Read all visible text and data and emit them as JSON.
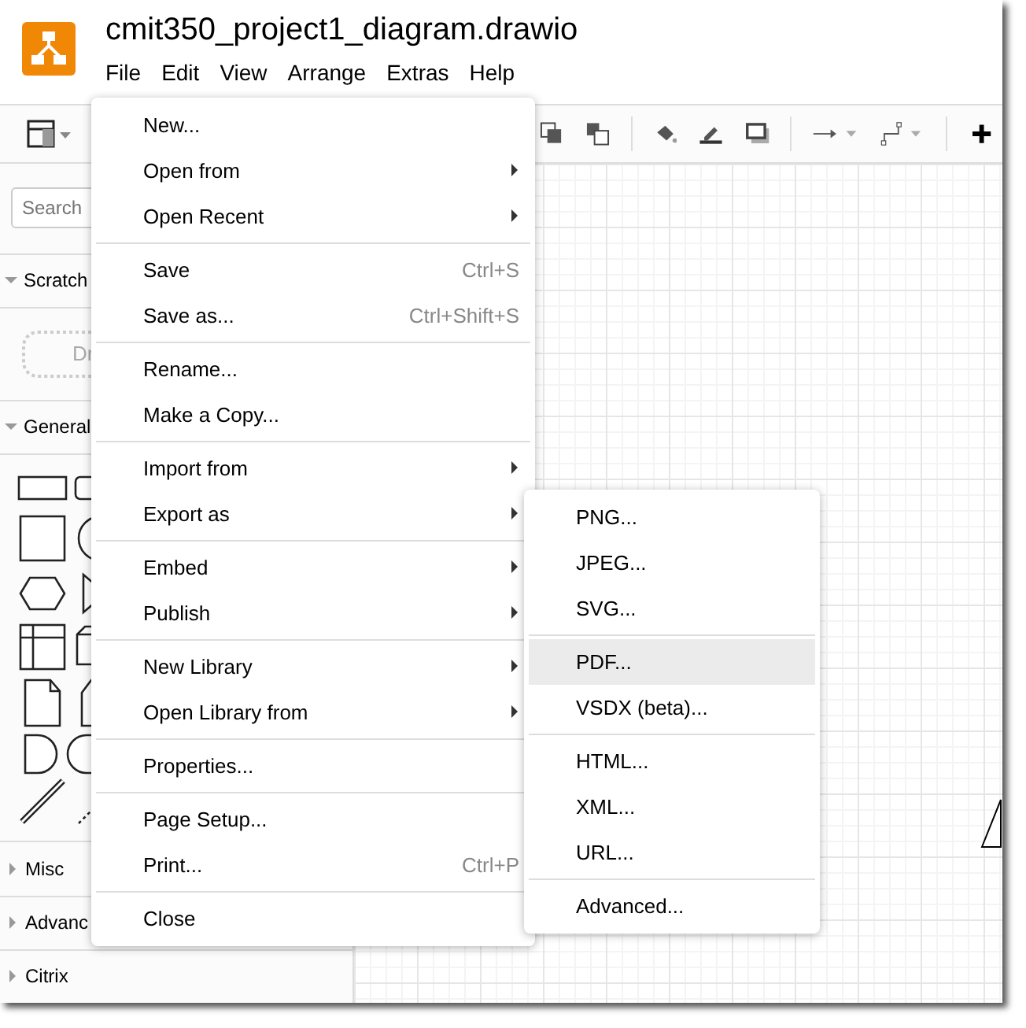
{
  "window": {
    "title": "cmit350_project1_diagram.drawio"
  },
  "menubar": [
    "File",
    "Edit",
    "View",
    "Arrange",
    "Extras",
    "Help"
  ],
  "sidebar": {
    "search": {
      "placeholder": "Search"
    },
    "scratchpad": {
      "title": "Scratch",
      "drop_hint": "Dr"
    },
    "sections": [
      {
        "title": "General",
        "expanded": true
      },
      {
        "title": "Misc",
        "expanded": false
      },
      {
        "title": "Advanc",
        "expanded": false
      },
      {
        "title": "Citrix",
        "expanded": false
      }
    ]
  },
  "file_menu": [
    {
      "kind": "item",
      "label": "New...",
      "submenu": false
    },
    {
      "kind": "item",
      "label": "Open from",
      "submenu": true
    },
    {
      "kind": "item",
      "label": "Open Recent",
      "submenu": true
    },
    {
      "kind": "separator"
    },
    {
      "kind": "item",
      "label": "Save",
      "shortcut": "Ctrl+S",
      "submenu": false
    },
    {
      "kind": "item",
      "label": "Save as...",
      "shortcut": "Ctrl+Shift+S",
      "submenu": false
    },
    {
      "kind": "separator"
    },
    {
      "kind": "item",
      "label": "Rename...",
      "submenu": false
    },
    {
      "kind": "item",
      "label": "Make a Copy...",
      "submenu": false
    },
    {
      "kind": "separator"
    },
    {
      "kind": "item",
      "label": "Import from",
      "submenu": true
    },
    {
      "kind": "item",
      "label": "Export as",
      "submenu": true
    },
    {
      "kind": "separator"
    },
    {
      "kind": "item",
      "label": "Embed",
      "submenu": true
    },
    {
      "kind": "item",
      "label": "Publish",
      "submenu": true
    },
    {
      "kind": "separator"
    },
    {
      "kind": "item",
      "label": "New Library",
      "submenu": true
    },
    {
      "kind": "item",
      "label": "Open Library from",
      "submenu": true
    },
    {
      "kind": "separator"
    },
    {
      "kind": "item",
      "label": "Properties...",
      "submenu": false
    },
    {
      "kind": "separator"
    },
    {
      "kind": "item",
      "label": "Page Setup...",
      "submenu": false
    },
    {
      "kind": "item",
      "label": "Print...",
      "shortcut": "Ctrl+P",
      "submenu": false
    },
    {
      "kind": "separator"
    },
    {
      "kind": "item",
      "label": "Close",
      "submenu": false
    }
  ],
  "export_submenu": [
    {
      "kind": "item",
      "label": "PNG...",
      "selected": false
    },
    {
      "kind": "item",
      "label": "JPEG...",
      "selected": false
    },
    {
      "kind": "item",
      "label": "SVG...",
      "selected": false
    },
    {
      "kind": "separator"
    },
    {
      "kind": "item",
      "label": "PDF...",
      "selected": true
    },
    {
      "kind": "item",
      "label": "VSDX (beta)...",
      "selected": false
    },
    {
      "kind": "separator"
    },
    {
      "kind": "item",
      "label": "HTML...",
      "selected": false
    },
    {
      "kind": "item",
      "label": "XML...",
      "selected": false
    },
    {
      "kind": "item",
      "label": "URL...",
      "selected": false
    },
    {
      "kind": "separator"
    },
    {
      "kind": "item",
      "label": "Advanced...",
      "selected": false
    }
  ]
}
